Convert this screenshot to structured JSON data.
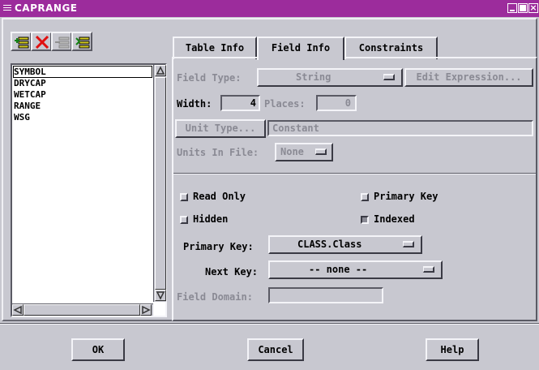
{
  "window": {
    "title": "CAPRANGE"
  },
  "toolbar": {
    "icons": [
      "add-field-icon",
      "delete-field-icon",
      "insert-field-icon",
      "edit-fields-icon"
    ]
  },
  "fields_list": {
    "items": [
      "SYMBOL",
      "DRYCAP",
      "WETCAP",
      "RANGE",
      "WSG"
    ],
    "selected": "SYMBOL"
  },
  "tabs": [
    "Table Info",
    "Field Info",
    "Constraints"
  ],
  "active_tab": "Field Info",
  "field_info": {
    "field_type_label": "Field Type:",
    "field_type_value": "String",
    "edit_expression_label": "Edit Expression...",
    "width_label": "Width:",
    "width_value": "4",
    "places_label": "Places:",
    "places_value": "0",
    "unit_type_label": "Unit Type...",
    "unit_type_value": "Constant",
    "units_in_file_label": "Units In File:",
    "units_in_file_value": "None",
    "read_only_label": "Read Only",
    "primary_key_check_label": "Primary Key",
    "hidden_label": "Hidden",
    "indexed_label": "Indexed",
    "primary_key_label": "Primary Key:",
    "primary_key_value": "CLASS.Class",
    "next_key_label": "Next Key:",
    "next_key_value": "-- none --",
    "field_domain_label": "Field Domain:",
    "field_domain_value": ""
  },
  "checkboxes": {
    "read_only": false,
    "primary_key": false,
    "hidden": false,
    "indexed": true
  },
  "buttons": {
    "ok": "OK",
    "cancel": "Cancel",
    "help": "Help"
  },
  "colors": {
    "titlebar": "#9c2c9c",
    "background": "#c8c8d0",
    "disabled_text": "#8a8a94"
  }
}
